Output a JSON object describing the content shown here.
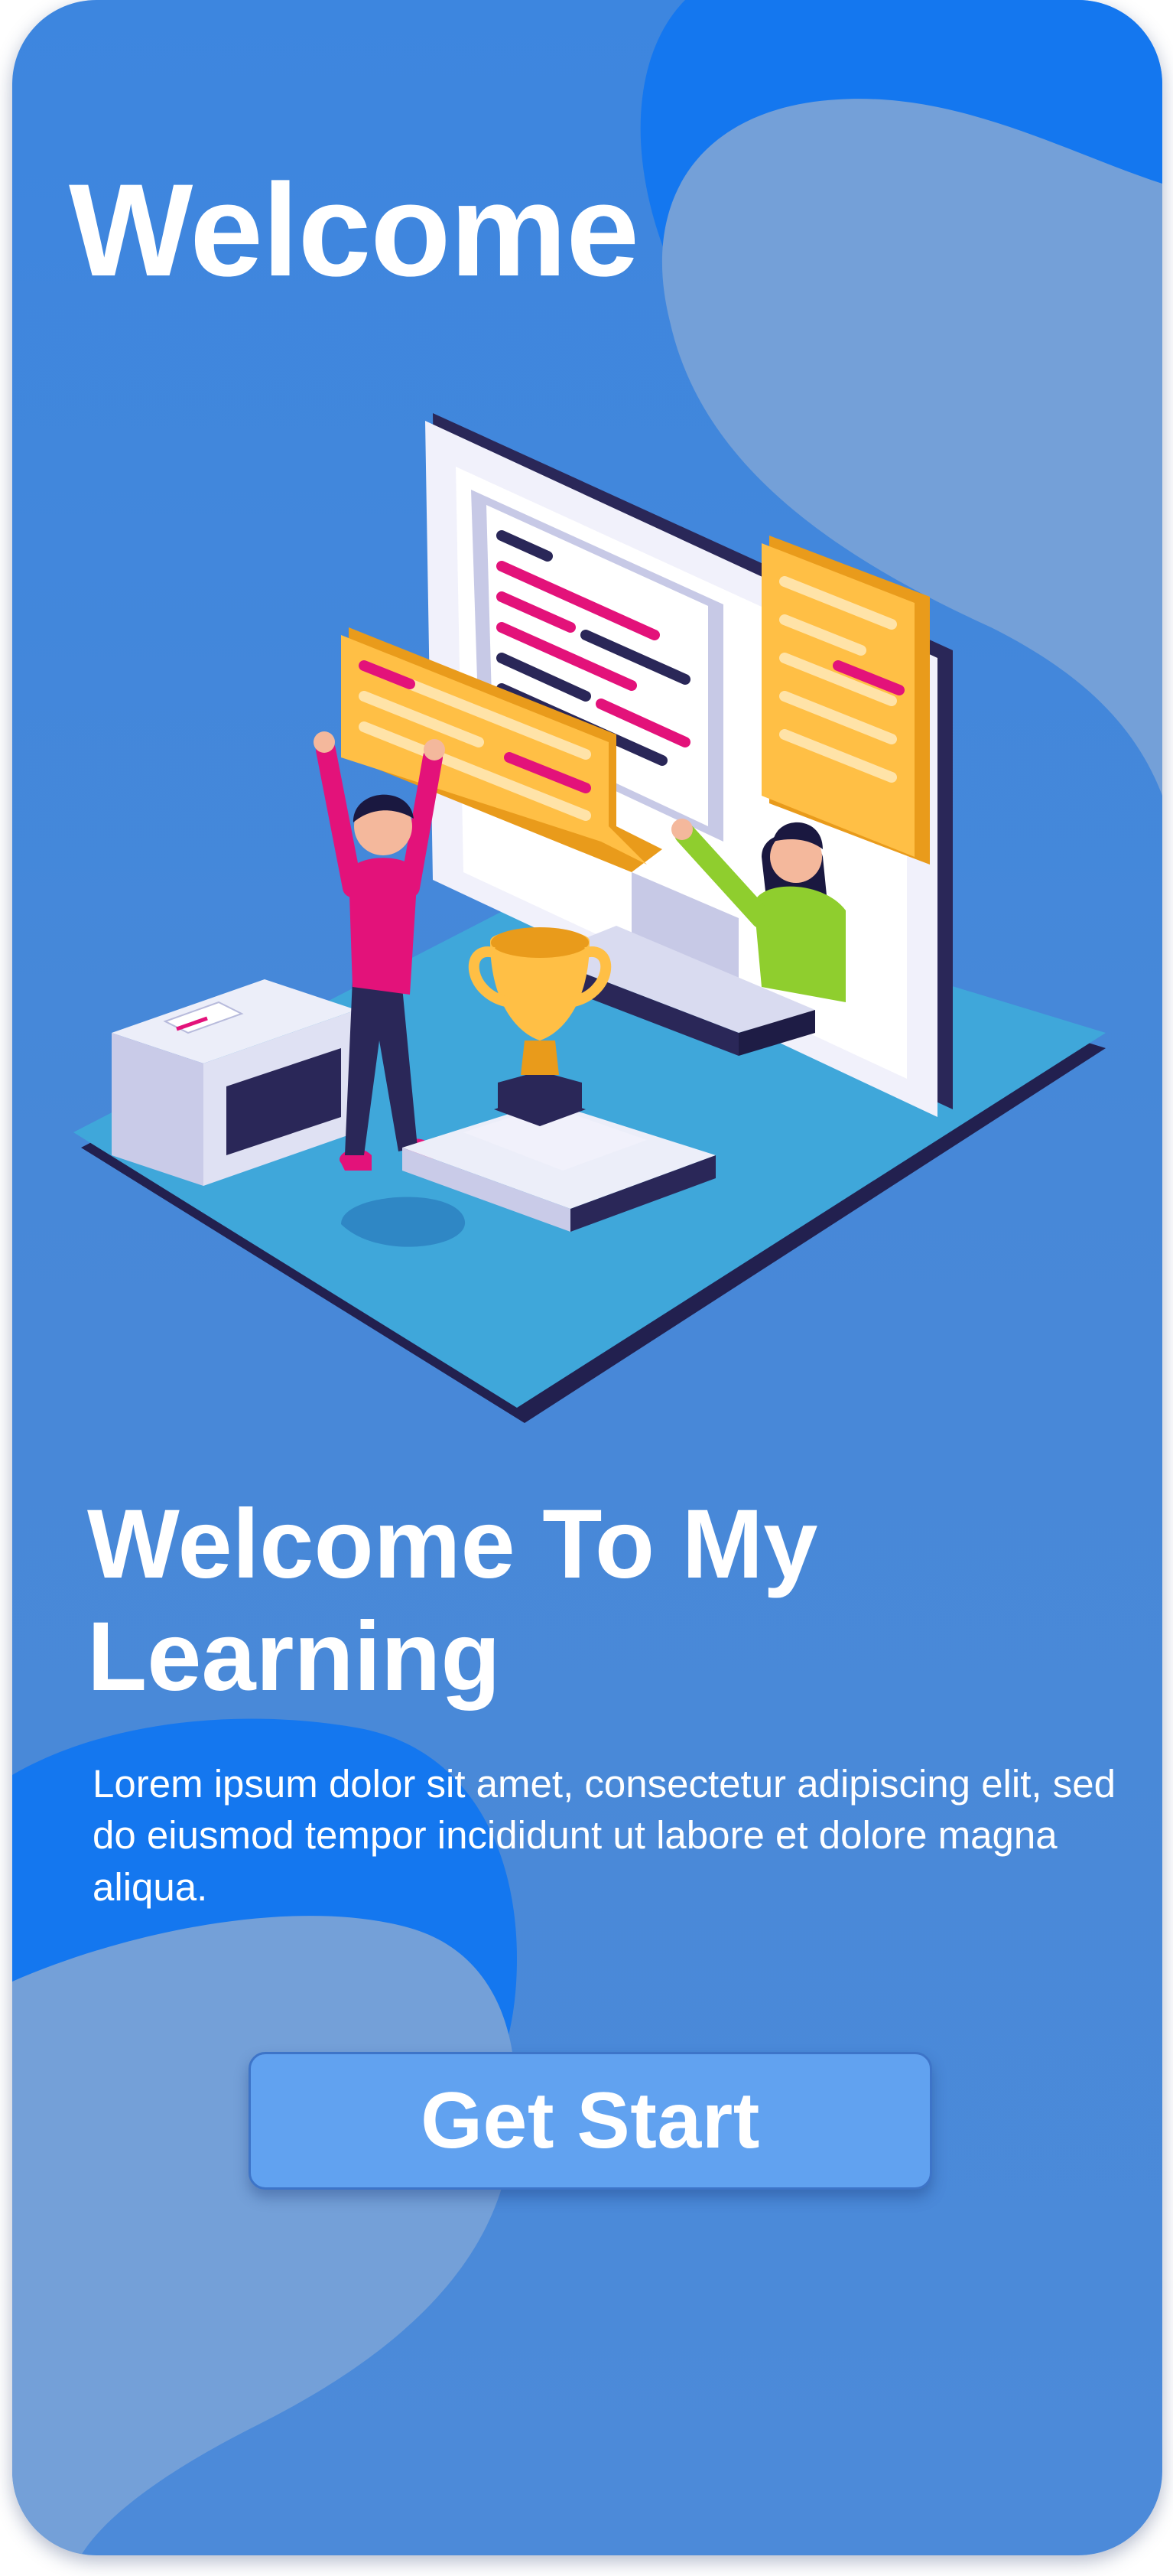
{
  "screen": {
    "heading": "Welcome",
    "title": "Welcome To My Learning",
    "description": "Lorem ipsum dolor sit amet, consectetur adipiscing elit, sed do eiusmod tempor incididunt ut labore et dolore magna aliqua.",
    "cta_label": "Get Start"
  },
  "illustration": {
    "subject": "e-learning-scene",
    "elements": [
      "monitor",
      "chat-bubble",
      "student",
      "teacher",
      "trophy",
      "desk",
      "platform"
    ]
  },
  "colors": {
    "background": "#4788d8",
    "blob_bright": "#1477ef",
    "blob_soft": "#74a0d8",
    "button": "#61a2f0",
    "text": "#ffffff"
  }
}
